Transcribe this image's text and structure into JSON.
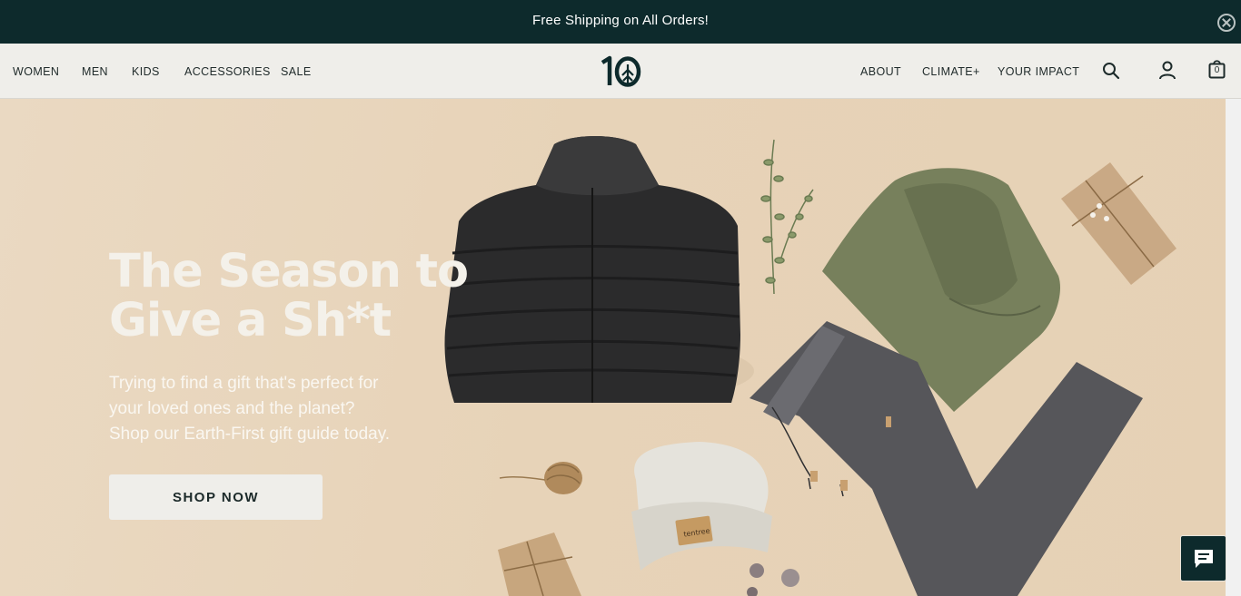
{
  "announcement": {
    "text": "Free Shipping on All Orders!"
  },
  "nav": {
    "left": [
      "WOMEN",
      "MEN",
      "KIDS",
      "ACCESSORIES",
      "SALE"
    ],
    "right": [
      "ABOUT",
      "CLIMATE+",
      "YOUR IMPACT"
    ],
    "cart_count": "0",
    "logo_text": "10",
    "icons": [
      "search-icon",
      "account-icon",
      "cart-icon",
      "close-icon"
    ]
  },
  "hero": {
    "headline_line1": "The Season to",
    "headline_line2": "Give a Sh*t",
    "sub_line1": "Trying to find a gift that's perfect for",
    "sub_line2": "your loved ones and the planet?",
    "sub_line3": "Shop our Earth-First gift guide today.",
    "cta": "SHOP NOW",
    "beanie_label": "tentree"
  },
  "colors": {
    "brand_dark": "#0d2a2c",
    "nav_bg": "#efeeea",
    "hero_bg": "#e7d3b8",
    "text_light": "#f4f1ea"
  }
}
